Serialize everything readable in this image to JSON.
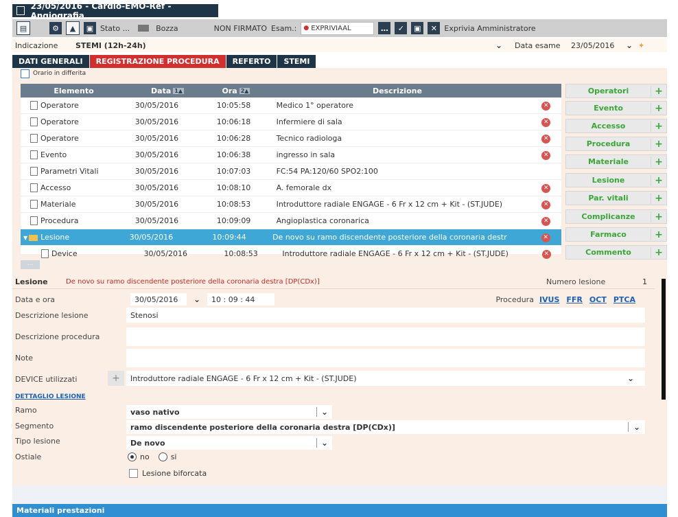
{
  "window": {
    "title": "23/05/2016 - Cardio-EMO-Ref - Angiografia"
  },
  "toolbar": {
    "stato_label": "Stato ...",
    "stato_value": "Bozza",
    "firma": "NON FIRMATO",
    "esam_label": "Esam.:",
    "esam_value": "EXPRIVIAAL",
    "user": "Exprivia Amministratore"
  },
  "indicazione": {
    "label": "Indicazione",
    "value": "STEMI (12h-24h)",
    "data_esame_label": "Data esame",
    "data_esame_value": "23/05/2016"
  },
  "tabs": [
    {
      "label": "DATI GENERALI"
    },
    {
      "label": "REGISTRAZIONE PROCEDURA"
    },
    {
      "label": "REFERTO"
    },
    {
      "label": "STEMI"
    }
  ],
  "orario_differita": "Orario in differita",
  "grid": {
    "headers": {
      "elemento": "Elemento",
      "data": "Data",
      "data_sort": "1▲",
      "ora": "Ora",
      "ora_sort": "2▲",
      "descrizione": "Descrizione"
    },
    "rows": [
      {
        "elemento": "Operatore",
        "data": "30/05/2016",
        "ora": "10:05:58",
        "descrizione": "Medico 1° operatore"
      },
      {
        "elemento": "Operatore",
        "data": "30/05/2016",
        "ora": "10:06:18",
        "descrizione": "Infermiere di sala"
      },
      {
        "elemento": "Operatore",
        "data": "30/05/2016",
        "ora": "10:06:28",
        "descrizione": "Tecnico radiologa"
      },
      {
        "elemento": "Evento",
        "data": "30/05/2016",
        "ora": "10:06:38",
        "descrizione": "ingresso in sala"
      },
      {
        "elemento": "Parametri Vitali",
        "data": "30/05/2016",
        "ora": "10:07:03",
        "descrizione": "FC:54  PA:120/60  SPO2:100"
      },
      {
        "elemento": "Accesso",
        "data": "30/05/2016",
        "ora": "10:08:10",
        "descrizione": "A. femorale dx"
      },
      {
        "elemento": "Materiale",
        "data": "30/05/2016",
        "ora": "10:08:53",
        "descrizione": "Introduttore radiale ENGAGE - 6 Fr x 12 cm + Kit - (ST.JUDE)"
      },
      {
        "elemento": "Procedura",
        "data": "30/05/2016",
        "ora": "10:09:09",
        "descrizione": "Angioplastica coronarica"
      },
      {
        "elemento": "Lesione",
        "data": "30/05/2016",
        "ora": "10:09:44",
        "descrizione": "De novo su ramo discendente posteriore della coronaria destr"
      },
      {
        "elemento": "Device",
        "data": "30/05/2016",
        "ora": "10:08:53",
        "descrizione": "Introduttore radiale ENGAGE - 6 Fr x 12 cm + Kit - (ST.JUDE)"
      }
    ]
  },
  "side_buttons": [
    {
      "label": "Operatori"
    },
    {
      "label": "Evento"
    },
    {
      "label": "Accesso"
    },
    {
      "label": "Procedura"
    },
    {
      "label": "Materiale"
    },
    {
      "label": "Lesione"
    },
    {
      "label": "Par. vitali"
    },
    {
      "label": "Complicanze"
    },
    {
      "label": "Farmaco"
    },
    {
      "label": "Commento"
    }
  ],
  "more_label": "...",
  "lesione_form": {
    "lesione_label": "Lesione",
    "lesione_value": "De novo su ramo discendente posteriore della coronaria destra [DP(CDx)]",
    "numero_label": "Numero lesione",
    "numero_value": "1",
    "data_ora_label": "Data e ora",
    "data_value": "30/05/2016",
    "ora_value": "10 : 09 : 44",
    "procedura_label": "Procedura",
    "procedura_links": [
      "IVUS",
      "FFR",
      "OCT",
      "PTCA"
    ],
    "desc_lesione_label": "Descrizione lesione",
    "desc_lesione_value": "Stenosi",
    "desc_procedura_label": "Descrizione procedura",
    "note_label": "Note",
    "device_label": "DEVICE utilizzati",
    "device_value": "Introduttore radiale ENGAGE - 6 Fr x 12 cm + Kit - (ST.JUDE)",
    "dettaglio_label": "DETTAGLIO LESIONE",
    "ramo_label": "Ramo",
    "ramo_value": "vaso nativo",
    "segmento_label": "Segmento",
    "segmento_value": "ramo discendente posteriore della coronaria destra [DP(CDx)]",
    "tipo_label": "Tipo lesione",
    "tipo_value": "De novo",
    "ostiale_label": "Ostiale",
    "ostiale_no": "no",
    "ostiale_si": "si",
    "biforcata_label": "Lesione biforcata"
  },
  "bottom": {
    "label": "Materiali prestazioni"
  },
  "colors": {
    "navy": "#1e3447",
    "accent_red": "#d32f2f",
    "selection": "#3fa7d6",
    "green": "#3aa636",
    "panel": "#fbefe5"
  }
}
